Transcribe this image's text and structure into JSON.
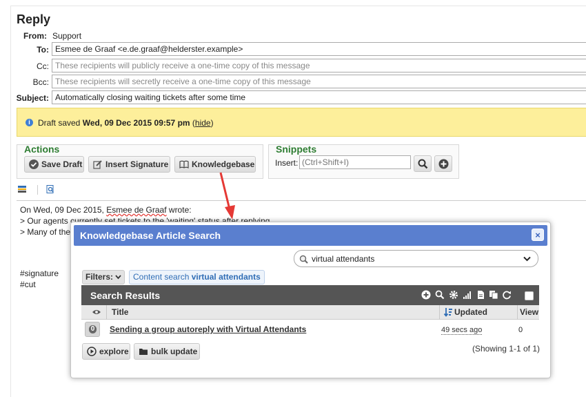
{
  "reply": {
    "title": "Reply",
    "from_label": "From:",
    "from_value": "Support",
    "to_label": "To:",
    "to_value": "Esmee de Graaf <e.de.graaf@helderster.example>",
    "cc_label": "Cc:",
    "cc_placeholder": "These recipients will publicly receive a one-time copy of this message",
    "bcc_label": "Bcc:",
    "bcc_placeholder": "These recipients will secretly receive a one-time copy of this message",
    "subject_label": "Subject:",
    "subject_value": "Automatically closing waiting tickets after some time"
  },
  "banner": {
    "prefix": "Draft saved ",
    "date": "Wed, 09 Dec 2015 09:57 pm",
    "open": " (",
    "hide": "hide",
    "close": ")"
  },
  "actions": {
    "title": "Actions",
    "save_draft": "Save Draft",
    "insert_signature": "Insert Signature",
    "knowledgebase": "Knowledgebase"
  },
  "snippets": {
    "title": "Snippets",
    "insert_label": "Insert:",
    "insert_placeholder": "(Ctrl+Shift+I)"
  },
  "editor": {
    "quote_prefix": "On Wed, 09 Dec 2015, ",
    "quote_author": "Esmee de Graaf",
    "quote_suffix": " wrote:",
    "line1": "> Our agents currently set tickets to the 'waiting' status after replying",
    "line2": "> Many of the",
    "signature": "#signature",
    "cut": "#cut"
  },
  "modal": {
    "title": "Knowledgebase Article Search",
    "close": "×",
    "search_value": "virtual attendants",
    "filters_label": "Filters:",
    "chip_prefix": "Content search ",
    "chip_value": "virtual attendants",
    "results_title": "Search Results",
    "col_title": "Title",
    "col_updated": "Updated",
    "col_views": "View",
    "row": {
      "count": "0",
      "title": "Sending a group autoreply with Virtual Attendants",
      "updated": "49 secs ago",
      "views": "0"
    },
    "explore": "explore",
    "bulk_update": "bulk update",
    "showing": "(Showing 1-1 of 1)"
  },
  "colors": {
    "accent": "#5a7fcf",
    "banner": "#fdef9b",
    "section_title": "#2e7d32",
    "arrow": "#e53935"
  }
}
